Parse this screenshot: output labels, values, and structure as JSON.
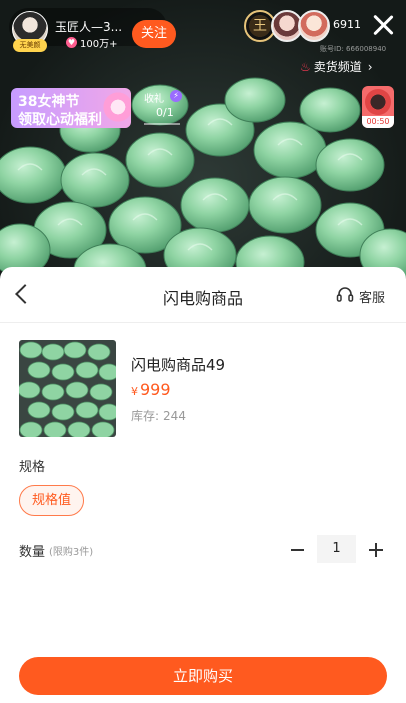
{
  "host": {
    "avatar_tag": "无美颜",
    "name": "玉匠人—3...",
    "likes": "100万+",
    "follow_label": "关注"
  },
  "viewers": {
    "count": "6911",
    "first_avatar_glyph": "王"
  },
  "room_id": "账号ID: 666008940",
  "channel": {
    "label": "卖货频道",
    "icon": "flame-icon"
  },
  "promo": {
    "line1": "38女神节",
    "line2": "领取心动福利"
  },
  "gift": {
    "label": "收礼",
    "value": "0/1"
  },
  "side_widget": {
    "timer": "00:50"
  },
  "sheet": {
    "title": "闪电购商品",
    "customer_service_label": "客服"
  },
  "product": {
    "name": "闪电购商品49",
    "currency": "¥",
    "price": "999",
    "stock_label": "库存:",
    "stock_value": "244"
  },
  "spec": {
    "label": "规格",
    "options": [
      "规格值"
    ],
    "selected": "规格值"
  },
  "quantity": {
    "label": "数量",
    "limit": "(限购3件)",
    "value": "1"
  },
  "buy_button": {
    "label": "立即购买"
  },
  "colors": {
    "accent": "#ff5a1f",
    "sheet_bg": "#ffffff",
    "jade": "#8fd4a3"
  }
}
